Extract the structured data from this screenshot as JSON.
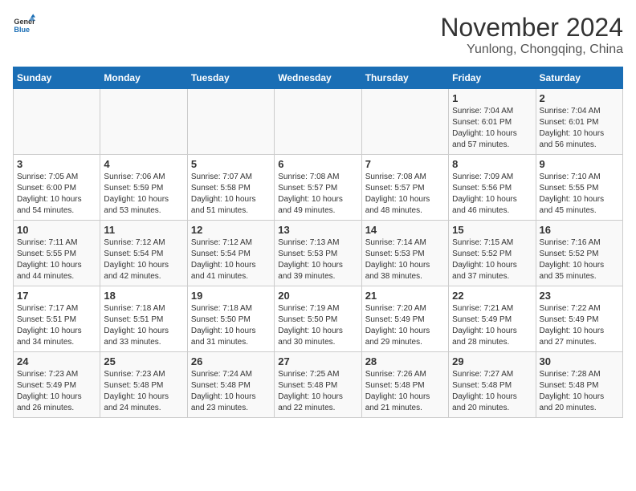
{
  "logo": {
    "line1": "General",
    "line2": "Blue"
  },
  "title": "November 2024",
  "subtitle": "Yunlong, Chongqing, China",
  "weekdays": [
    "Sunday",
    "Monday",
    "Tuesday",
    "Wednesday",
    "Thursday",
    "Friday",
    "Saturday"
  ],
  "weeks": [
    [
      {
        "day": "",
        "info": ""
      },
      {
        "day": "",
        "info": ""
      },
      {
        "day": "",
        "info": ""
      },
      {
        "day": "",
        "info": ""
      },
      {
        "day": "",
        "info": ""
      },
      {
        "day": "1",
        "info": "Sunrise: 7:04 AM\nSunset: 6:01 PM\nDaylight: 10 hours and 57 minutes."
      },
      {
        "day": "2",
        "info": "Sunrise: 7:04 AM\nSunset: 6:01 PM\nDaylight: 10 hours and 56 minutes."
      }
    ],
    [
      {
        "day": "3",
        "info": "Sunrise: 7:05 AM\nSunset: 6:00 PM\nDaylight: 10 hours and 54 minutes."
      },
      {
        "day": "4",
        "info": "Sunrise: 7:06 AM\nSunset: 5:59 PM\nDaylight: 10 hours and 53 minutes."
      },
      {
        "day": "5",
        "info": "Sunrise: 7:07 AM\nSunset: 5:58 PM\nDaylight: 10 hours and 51 minutes."
      },
      {
        "day": "6",
        "info": "Sunrise: 7:08 AM\nSunset: 5:57 PM\nDaylight: 10 hours and 49 minutes."
      },
      {
        "day": "7",
        "info": "Sunrise: 7:08 AM\nSunset: 5:57 PM\nDaylight: 10 hours and 48 minutes."
      },
      {
        "day": "8",
        "info": "Sunrise: 7:09 AM\nSunset: 5:56 PM\nDaylight: 10 hours and 46 minutes."
      },
      {
        "day": "9",
        "info": "Sunrise: 7:10 AM\nSunset: 5:55 PM\nDaylight: 10 hours and 45 minutes."
      }
    ],
    [
      {
        "day": "10",
        "info": "Sunrise: 7:11 AM\nSunset: 5:55 PM\nDaylight: 10 hours and 44 minutes."
      },
      {
        "day": "11",
        "info": "Sunrise: 7:12 AM\nSunset: 5:54 PM\nDaylight: 10 hours and 42 minutes."
      },
      {
        "day": "12",
        "info": "Sunrise: 7:12 AM\nSunset: 5:54 PM\nDaylight: 10 hours and 41 minutes."
      },
      {
        "day": "13",
        "info": "Sunrise: 7:13 AM\nSunset: 5:53 PM\nDaylight: 10 hours and 39 minutes."
      },
      {
        "day": "14",
        "info": "Sunrise: 7:14 AM\nSunset: 5:53 PM\nDaylight: 10 hours and 38 minutes."
      },
      {
        "day": "15",
        "info": "Sunrise: 7:15 AM\nSunset: 5:52 PM\nDaylight: 10 hours and 37 minutes."
      },
      {
        "day": "16",
        "info": "Sunrise: 7:16 AM\nSunset: 5:52 PM\nDaylight: 10 hours and 35 minutes."
      }
    ],
    [
      {
        "day": "17",
        "info": "Sunrise: 7:17 AM\nSunset: 5:51 PM\nDaylight: 10 hours and 34 minutes."
      },
      {
        "day": "18",
        "info": "Sunrise: 7:18 AM\nSunset: 5:51 PM\nDaylight: 10 hours and 33 minutes."
      },
      {
        "day": "19",
        "info": "Sunrise: 7:18 AM\nSunset: 5:50 PM\nDaylight: 10 hours and 31 minutes."
      },
      {
        "day": "20",
        "info": "Sunrise: 7:19 AM\nSunset: 5:50 PM\nDaylight: 10 hours and 30 minutes."
      },
      {
        "day": "21",
        "info": "Sunrise: 7:20 AM\nSunset: 5:49 PM\nDaylight: 10 hours and 29 minutes."
      },
      {
        "day": "22",
        "info": "Sunrise: 7:21 AM\nSunset: 5:49 PM\nDaylight: 10 hours and 28 minutes."
      },
      {
        "day": "23",
        "info": "Sunrise: 7:22 AM\nSunset: 5:49 PM\nDaylight: 10 hours and 27 minutes."
      }
    ],
    [
      {
        "day": "24",
        "info": "Sunrise: 7:23 AM\nSunset: 5:49 PM\nDaylight: 10 hours and 26 minutes."
      },
      {
        "day": "25",
        "info": "Sunrise: 7:23 AM\nSunset: 5:48 PM\nDaylight: 10 hours and 24 minutes."
      },
      {
        "day": "26",
        "info": "Sunrise: 7:24 AM\nSunset: 5:48 PM\nDaylight: 10 hours and 23 minutes."
      },
      {
        "day": "27",
        "info": "Sunrise: 7:25 AM\nSunset: 5:48 PM\nDaylight: 10 hours and 22 minutes."
      },
      {
        "day": "28",
        "info": "Sunrise: 7:26 AM\nSunset: 5:48 PM\nDaylight: 10 hours and 21 minutes."
      },
      {
        "day": "29",
        "info": "Sunrise: 7:27 AM\nSunset: 5:48 PM\nDaylight: 10 hours and 20 minutes."
      },
      {
        "day": "30",
        "info": "Sunrise: 7:28 AM\nSunset: 5:48 PM\nDaylight: 10 hours and 20 minutes."
      }
    ]
  ]
}
